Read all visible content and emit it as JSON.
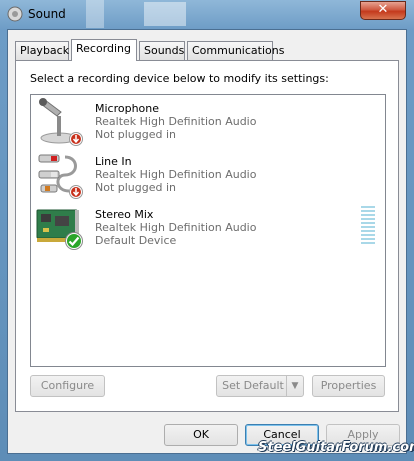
{
  "window": {
    "title": "Sound",
    "close_label": "✕"
  },
  "tabs": [
    {
      "label": "Playback"
    },
    {
      "label": "Recording"
    },
    {
      "label": "Sounds"
    },
    {
      "label": "Communications"
    }
  ],
  "active_tab": "Recording",
  "instruction": "Select a recording device below to modify its settings:",
  "devices": [
    {
      "name": "Microphone",
      "driver": "Realtek High Definition Audio",
      "status": "Not plugged in",
      "icon": "microphone-icon",
      "badge": "unplugged-badge"
    },
    {
      "name": "Line In",
      "driver": "Realtek High Definition Audio",
      "status": "Not plugged in",
      "icon": "line-in-cable-icon",
      "badge": "unplugged-badge"
    },
    {
      "name": "Stereo Mix",
      "driver": "Realtek High Definition Audio",
      "status": "Default Device",
      "icon": "sound-card-icon",
      "badge": "default-check-badge"
    }
  ],
  "buttons": {
    "configure": "Configure",
    "set_default": "Set Default",
    "properties": "Properties",
    "ok": "OK",
    "cancel": "Cancel",
    "apply": "Apply"
  },
  "watermark": "SteelGuitarForum.com",
  "colors": {
    "title_bar": "#6d9cc6",
    "close_button": "#c4391c",
    "level_meter": "#a9d8e8",
    "check_badge": "#2aa52a",
    "unplugged_badge": "#c8311c"
  }
}
